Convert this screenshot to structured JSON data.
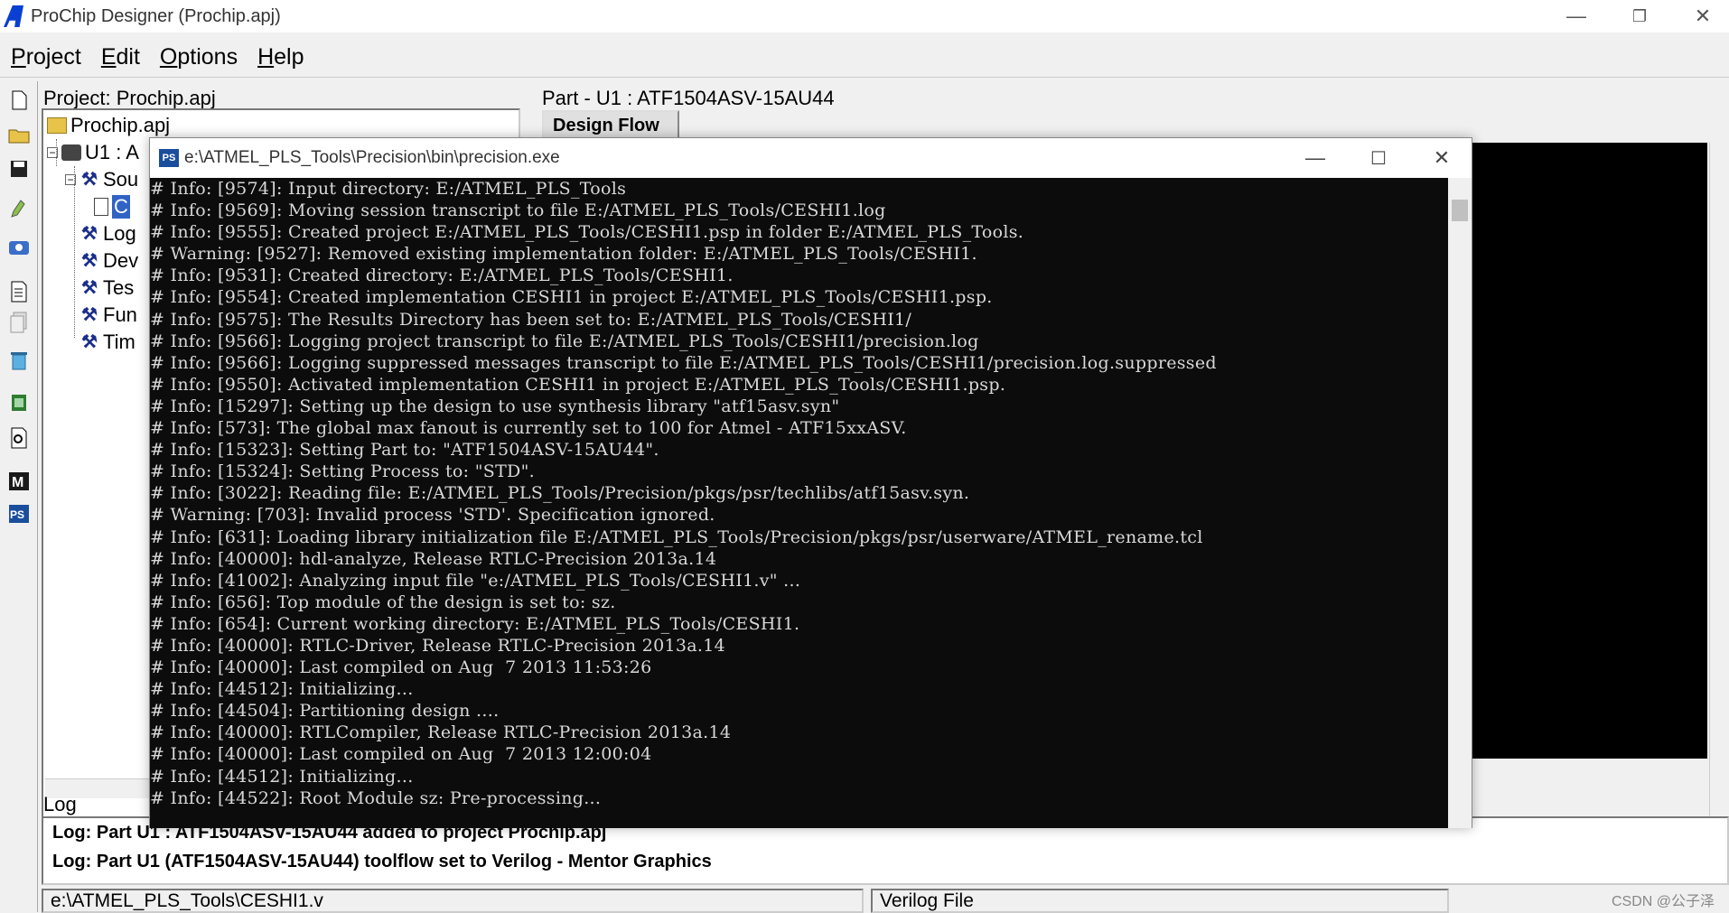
{
  "window": {
    "title": "ProChip Designer (Prochip.apj)",
    "minimize": "—",
    "restore": "❐",
    "close": "✕"
  },
  "menu": {
    "project": {
      "u": "P",
      "rest": "roject"
    },
    "edit": {
      "u": "E",
      "rest": "dit"
    },
    "options": {
      "u": "O",
      "rest": "ptions"
    },
    "help": {
      "u": "H",
      "rest": "elp"
    }
  },
  "left": {
    "project_label": "Project: Prochip.apj",
    "tree": {
      "root": "Prochip.apj",
      "u1": "U1 : A",
      "sources": "Sou",
      "file": "C",
      "log": "Log",
      "dev": "Dev",
      "tes": "Tes",
      "fun": "Fun",
      "tim": "Tim"
    }
  },
  "right": {
    "part_label": "Part - U1 : ATF1504ASV-15AU44",
    "design_flow": "Design Flow"
  },
  "log": {
    "label": "Log",
    "lines": [
      "Log: Part U1 : ATF1504ASV-15AU44 added to project Prochip.apj",
      "Log: Part U1 (ATF1504ASV-15AU44)  toolflow set to Verilog - Mentor Graphics"
    ]
  },
  "status": {
    "file_path": "e:\\ATMEL_PLS_Tools\\CESHI1.v",
    "file_type": "Verilog File"
  },
  "watermark": "CSDN @公子泽",
  "console": {
    "title": "e:\\ATMEL_PLS_Tools\\Precision\\bin\\precision.exe",
    "icon": "PS",
    "lines": [
      "# Info: [9574]: Input directory: E:/ATMEL_PLS_Tools",
      "# Info: [9569]: Moving session transcript to file E:/ATMEL_PLS_Tools/CESHI1.log",
      "# Info: [9555]: Created project E:/ATMEL_PLS_Tools/CESHI1.psp in folder E:/ATMEL_PLS_Tools.",
      "# Warning: [9527]: Removed existing implementation folder: E:/ATMEL_PLS_Tools/CESHI1.",
      "# Info: [9531]: Created directory: E:/ATMEL_PLS_Tools/CESHI1.",
      "# Info: [9554]: Created implementation CESHI1 in project E:/ATMEL_PLS_Tools/CESHI1.psp.",
      "# Info: [9575]: The Results Directory has been set to: E:/ATMEL_PLS_Tools/CESHI1/",
      "# Info: [9566]: Logging project transcript to file E:/ATMEL_PLS_Tools/CESHI1/precision.log",
      "# Info: [9566]: Logging suppressed messages transcript to file E:/ATMEL_PLS_Tools/CESHI1/precision.log.suppressed",
      "# Info: [9550]: Activated implementation CESHI1 in project E:/ATMEL_PLS_Tools/CESHI1.psp.",
      "# Info: [15297]: Setting up the design to use synthesis library \"atf15asv.syn\"",
      "# Info: [573]: The global max fanout is currently set to 100 for Atmel - ATF15xxASV.",
      "# Info: [15323]: Setting Part to: \"ATF1504ASV-15AU44\".",
      "# Info: [15324]: Setting Process to: \"STD\".",
      "# Info: [3022]: Reading file: E:/ATMEL_PLS_Tools/Precision/pkgs/psr/techlibs/atf15asv.syn.",
      "# Warning: [703]: Invalid process 'STD'. Specification ignored.",
      "# Info: [631]: Loading library initialization file E:/ATMEL_PLS_Tools/Precision/pkgs/psr/userware/ATMEL_rename.tcl",
      "# Info: [40000]: hdl-analyze, Release RTLC-Precision 2013a.14",
      "# Info: [41002]: Analyzing input file \"e:/ATMEL_PLS_Tools/CESHI1.v\" ...",
      "# Info: [656]: Top module of the design is set to: sz.",
      "# Info: [654]: Current working directory: E:/ATMEL_PLS_Tools/CESHI1.",
      "# Info: [40000]: RTLC-Driver, Release RTLC-Precision 2013a.14",
      "# Info: [40000]: Last compiled on Aug  7 2013 11:53:26",
      "# Info: [44512]: Initializing...",
      "# Info: [44504]: Partitioning design ....",
      "# Info: [40000]: RTLCompiler, Release RTLC-Precision 2013a.14",
      "# Info: [40000]: Last compiled on Aug  7 2013 12:00:04",
      "# Info: [44512]: Initializing...",
      "# Info: [44522]: Root Module sz: Pre-processing..."
    ]
  },
  "toolbar_icons": [
    "new-file-icon",
    "open-folder-icon",
    "save-icon",
    "clean-icon",
    "camera-icon",
    "report-icon",
    "copy-icon",
    "delete-icon",
    "device-icon",
    "inspect-icon",
    "mentor-icon",
    "precision-icon"
  ]
}
